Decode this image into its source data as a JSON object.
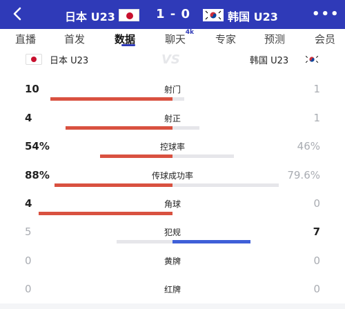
{
  "header": {
    "home_team": "日本 U23",
    "away_team": "韩国 U23",
    "score": "1 - 0",
    "more": "•••"
  },
  "tabs": [
    {
      "label": "直播",
      "active": false
    },
    {
      "label": "首发",
      "active": false
    },
    {
      "label": "数据",
      "active": true
    },
    {
      "label": "聊天",
      "active": false,
      "badge": "4k"
    },
    {
      "label": "专家",
      "active": false
    },
    {
      "label": "预测",
      "active": false
    },
    {
      "label": "会员",
      "active": false
    }
  ],
  "teams": {
    "home": "日本 U23",
    "away": "韩国 U23",
    "vs": "VS"
  },
  "colors": {
    "home": "#d95140",
    "away": "#3f5fd8",
    "track": "#e6e6ea",
    "header": "#2f3ab8"
  },
  "stats": [
    {
      "label": "射门",
      "home": "10",
      "away": "1",
      "home_frac": 0.91,
      "away_frac": 0.09,
      "lead": "home"
    },
    {
      "label": "射正",
      "home": "4",
      "away": "1",
      "home_frac": 0.8,
      "away_frac": 0.2,
      "lead": "home"
    },
    {
      "label": "控球率",
      "home": "54%",
      "away": "46%",
      "home_frac": 0.54,
      "away_frac": 0.46,
      "lead": "home"
    },
    {
      "label": "传球成功率",
      "home": "88%",
      "away": "79.6%",
      "home_frac": 0.88,
      "away_frac": 0.796,
      "lead": "home"
    },
    {
      "label": "角球",
      "home": "4",
      "away": "0",
      "home_frac": 1.0,
      "away_frac": 0.0,
      "lead": "home"
    },
    {
      "label": "犯规",
      "home": "5",
      "away": "7",
      "home_frac": 0.42,
      "away_frac": 0.58,
      "lead": "away"
    },
    {
      "label": "黄牌",
      "home": "0",
      "away": "0",
      "home_frac": 0.0,
      "away_frac": 0.0,
      "lead": "none"
    },
    {
      "label": "红牌",
      "home": "0",
      "away": "0",
      "home_frac": 0.0,
      "away_frac": 0.0,
      "lead": "none"
    }
  ]
}
